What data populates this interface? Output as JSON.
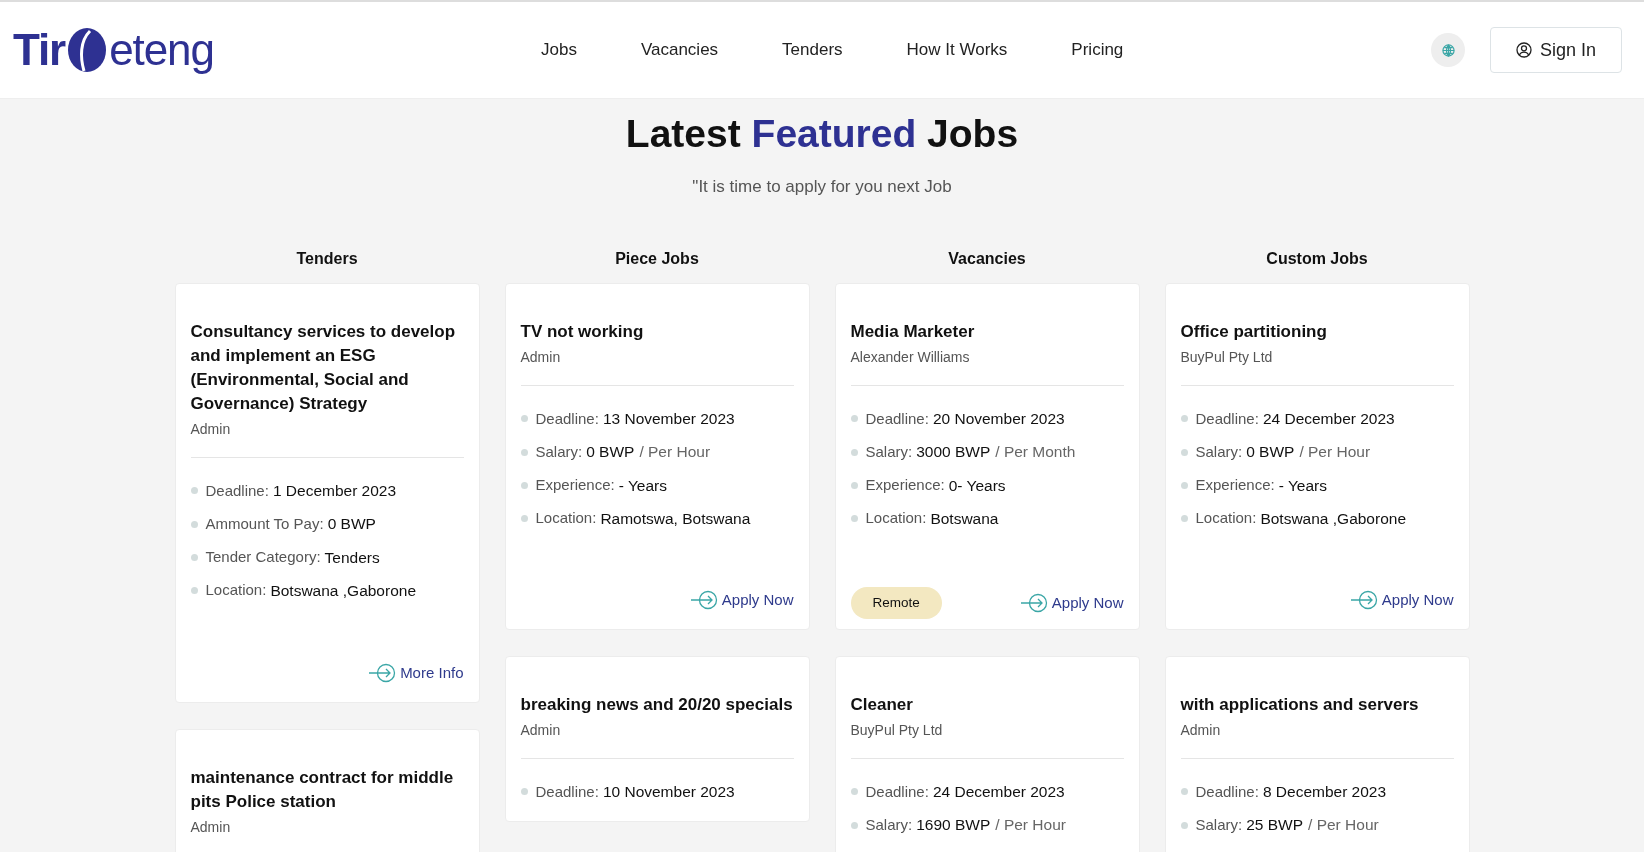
{
  "header": {
    "logo_left": "Tir",
    "logo_right": "eteng",
    "nav": [
      {
        "label": "Jobs"
      },
      {
        "label": "Vacancies"
      },
      {
        "label": "Tenders"
      },
      {
        "label": "How It Works"
      },
      {
        "label": "Pricing"
      }
    ],
    "sign_in": "Sign In"
  },
  "hero": {
    "title_before": "Latest",
    "title_highlight": "Featured",
    "title_after": "Jobs",
    "subtitle": "\"It is time to apply for you next Job"
  },
  "columns": [
    {
      "heading": "Tenders",
      "cards": [
        {
          "title": "Consultancy services to develop and implement an ESG (Environmental, Social and Governance) Strategy",
          "author": "Admin",
          "details": [
            {
              "label": "Deadline:",
              "value": "1 December 2023"
            },
            {
              "label": "Ammount To Pay:",
              "value": "0 BWP"
            },
            {
              "label": "Tender Category:",
              "value": "Tenders"
            },
            {
              "label": "Location:",
              "value": "Botswana ,Gaborone"
            }
          ],
          "action": "More Info"
        },
        {
          "title": "maintenance contract for middle pits Police station",
          "author": "Admin"
        }
      ]
    },
    {
      "heading": "Piece Jobs",
      "cards": [
        {
          "title": "TV not working",
          "author": "Admin",
          "details": [
            {
              "label": "Deadline:",
              "value": "13 November 2023"
            },
            {
              "label": "Salary:",
              "value": "0 BWP",
              "unit": "/ Per Hour"
            },
            {
              "label": "Experience:",
              "value": "- Years"
            },
            {
              "label": "Location:",
              "value": "Ramotswa, Botswana"
            }
          ],
          "action": "Apply Now"
        },
        {
          "title": "breaking news and 20/20 specials",
          "author": "Admin",
          "details": [
            {
              "label": "Deadline:",
              "value": "10 November 2023"
            }
          ]
        }
      ]
    },
    {
      "heading": "Vacancies",
      "cards": [
        {
          "title": "Media Marketer",
          "author": "Alexander Williams",
          "details": [
            {
              "label": "Deadline:",
              "value": "20 November 2023"
            },
            {
              "label": "Salary:",
              "value": "3000 BWP",
              "unit": "/ Per Month"
            },
            {
              "label": "Experience:",
              "value": "0- Years"
            },
            {
              "label": "Location:",
              "value": "Botswana"
            }
          ],
          "tag": "Remote",
          "action": "Apply Now"
        },
        {
          "title": "Cleaner",
          "author": "BuyPul Pty Ltd",
          "details": [
            {
              "label": "Deadline:",
              "value": "24 December 2023"
            },
            {
              "label": "Salary:",
              "value": "1690 BWP",
              "unit": "/ Per Hour"
            }
          ]
        }
      ]
    },
    {
      "heading": "Custom Jobs",
      "cards": [
        {
          "title": "Office partitioning",
          "author": "BuyPul Pty Ltd",
          "details": [
            {
              "label": "Deadline:",
              "value": "24 December 2023"
            },
            {
              "label": "Salary:",
              "value": "0 BWP",
              "unit": "/ Per Hour"
            },
            {
              "label": "Experience:",
              "value": "- Years"
            },
            {
              "label": "Location:",
              "value": "Botswana ,Gaborone"
            }
          ],
          "action": "Apply Now"
        },
        {
          "title": "with applications and servers",
          "author": "Admin",
          "details": [
            {
              "label": "Deadline:",
              "value": "8 December 2023"
            },
            {
              "label": "Salary:",
              "value": "25 BWP",
              "unit": "/ Per Hour"
            }
          ]
        }
      ]
    }
  ]
}
